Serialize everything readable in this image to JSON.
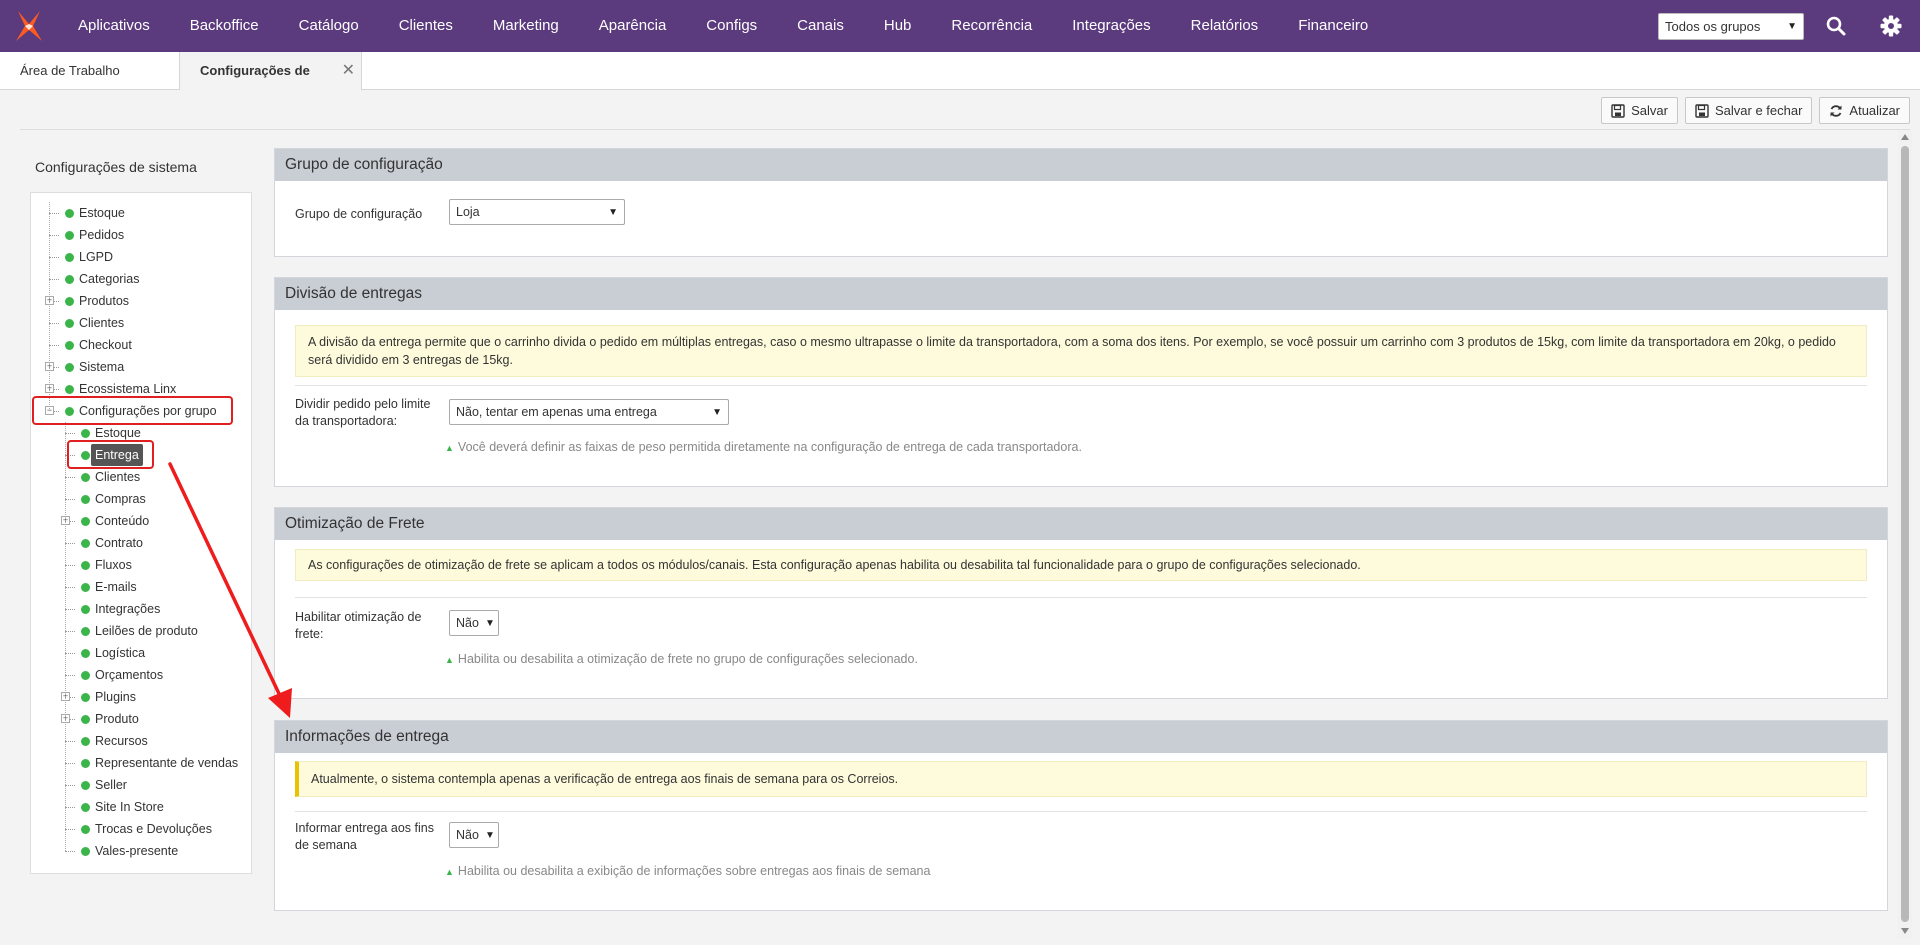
{
  "nav": {
    "menu": [
      "Aplicativos",
      "Backoffice",
      "Catálogo",
      "Clientes",
      "Marketing",
      "Aparência",
      "Configs",
      "Canais",
      "Hub",
      "Recorrência",
      "Integrações",
      "Relatórios",
      "Financeiro"
    ],
    "group_select": "Todos os grupos",
    "brand_color": "#5b3a7e"
  },
  "tabs": {
    "home": "Área de Trabalho",
    "active": "Configurações de sistem",
    "close": "✕"
  },
  "toolbar": {
    "save": "Salvar",
    "save_close": "Salvar e fechar",
    "refresh": "Atualizar"
  },
  "sidebar": {
    "title": "Configurações de sistema",
    "root_items": [
      "Estoque",
      "Pedidos",
      "LGPD",
      "Categorias",
      "Produtos",
      "Clientes",
      "Checkout",
      "Sistema",
      "Ecossistema Linx",
      "Configurações por grupo"
    ],
    "group_items": [
      "Estoque",
      "Entrega",
      "Clientes",
      "Compras",
      "Conteúdo",
      "Contrato",
      "Fluxos",
      "E-mails",
      "Integrações",
      "Leilões de produto",
      "Logística",
      "Orçamentos",
      "Plugins",
      "Produto",
      "Recursos",
      "Representante de vendas",
      "Seller",
      "Site In Store",
      "Trocas e Devoluções",
      "Vales-presente"
    ]
  },
  "panels": {
    "group": {
      "title": "Grupo de configuração",
      "label": "Grupo de configuração",
      "value": "Loja"
    },
    "split": {
      "title": "Divisão de entregas",
      "alert": "A divisão da entrega permite que o carrinho divida o pedido em múltiplas entregas, caso o mesmo ultrapasse o limite da transportadora, com a soma dos itens. Por exemplo, se você possuir um carrinho com 3 produtos de 15kg, com limite da transportadora em 20kg, o pedido será dividido em 3 entregas de 15kg.",
      "label": "Dividir pedido pelo limite da transportadora:",
      "value": "Não, tentar em apenas uma entrega",
      "hint": "Você deverá definir as faixas de peso permitida diretamente na configuração de entrega de cada transportadora."
    },
    "freight": {
      "title": "Otimização de Frete",
      "alert": "As configurações de otimização de frete se aplicam a todos os módulos/canais. Esta configuração apenas habilita ou desabilita tal funcionalidade para o grupo de configurações selecionado.",
      "label": "Habilitar otimização de frete:",
      "value": "Não",
      "hint": "Habilita ou desabilita a otimização de frete no grupo de configurações selecionado."
    },
    "delivery": {
      "title": "Informações de entrega",
      "alert": "Atualmente, o sistema contempla apenas a verificação de entrega aos finais de semana para os Correios.",
      "label": "Informar entrega aos fins de semana",
      "value": "Não",
      "hint": "Habilita ou desabilita a exibição de informações sobre entregas aos finais de semana"
    }
  }
}
